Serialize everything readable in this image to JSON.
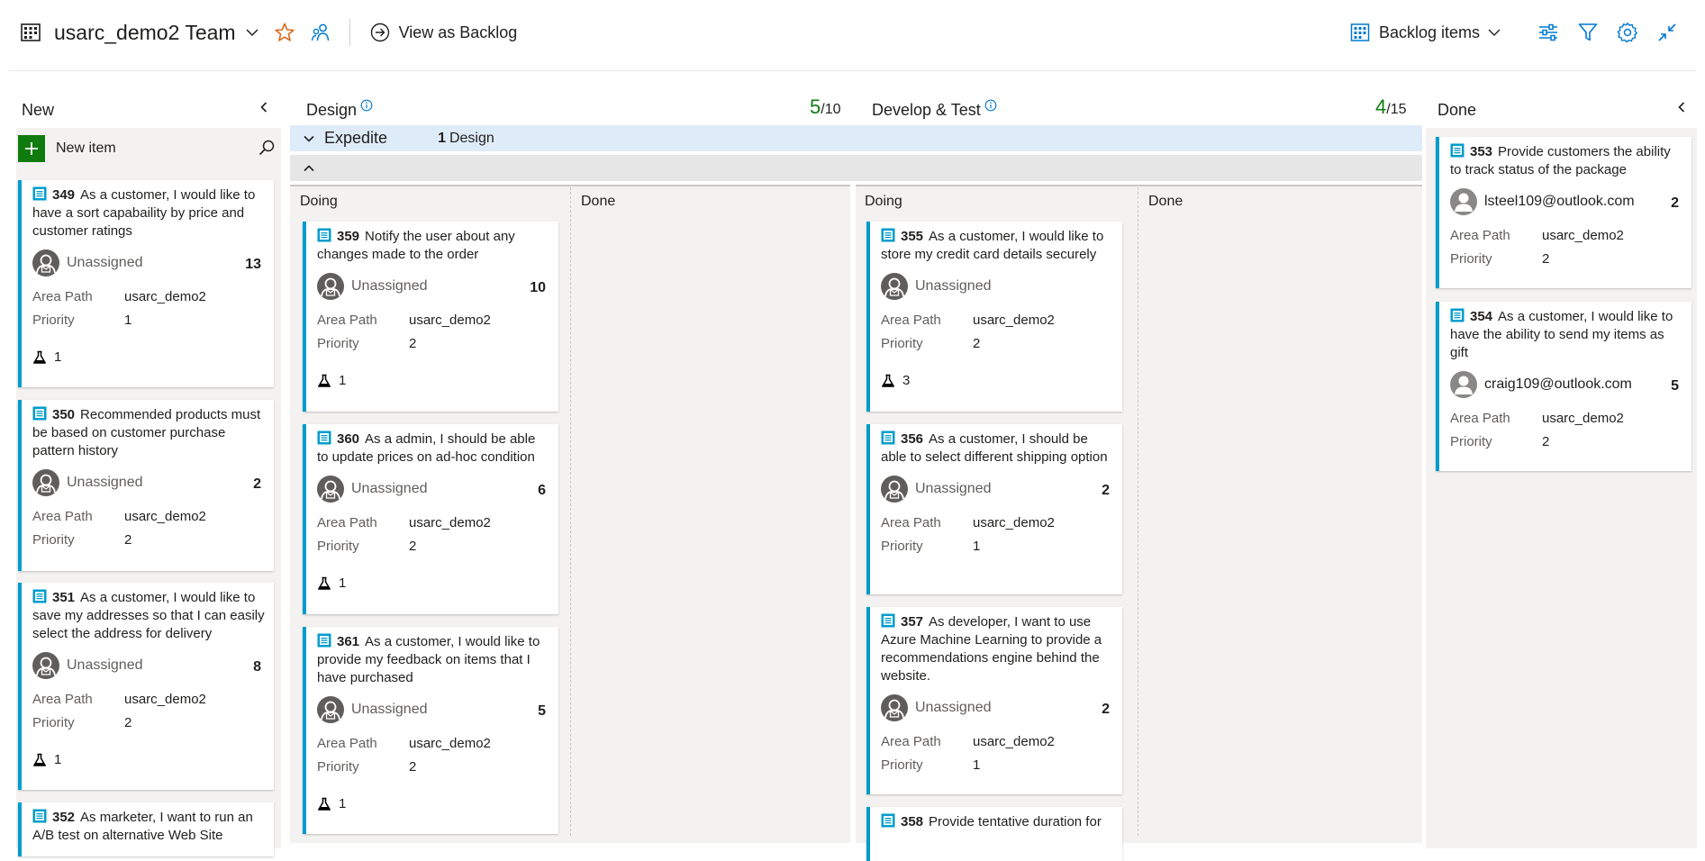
{
  "header": {
    "team_title": "usarc_demo2 Team",
    "view_backlog_label": "View as Backlog",
    "backlog_level_label": "Backlog items"
  },
  "field_labels": {
    "area_path": "Area Path",
    "priority": "Priority"
  },
  "colors": {
    "accent": "#0078d4",
    "card_bar": "#009ccc",
    "favorite": "#d86a1c",
    "wip_good": "#107c10",
    "lane_bg": "#deecf9"
  },
  "columns": {
    "new": {
      "title": "New",
      "new_item_label": "New item",
      "cards": [
        {
          "id": "349",
          "title": "As a customer, I would like to have a sort capabaility by price and customer ratings",
          "assignee": "Unassigned",
          "effort": "13",
          "area_path": "usarc_demo2",
          "priority": "1",
          "tests": "1"
        },
        {
          "id": "350",
          "title": "Recommended products must be based on customer purchase pattern history",
          "assignee": "Unassigned",
          "effort": "2",
          "area_path": "usarc_demo2",
          "priority": "2"
        },
        {
          "id": "351",
          "title": "As a customer, I would like to save my addresses so that I can easily select the address for delivery",
          "assignee": "Unassigned",
          "effort": "8",
          "area_path": "usarc_demo2",
          "priority": "2",
          "tests": "1"
        },
        {
          "id": "352",
          "title": "As marketer, I want to run an A/B test on alternative Web Site"
        }
      ]
    },
    "design": {
      "title": "Design",
      "wip_count": "5",
      "wip_limit": "/10",
      "doing_label": "Doing",
      "done_label": "Done",
      "cards": [
        {
          "id": "359",
          "title": "Notify the user about any changes made to the order",
          "assignee": "Unassigned",
          "effort": "10",
          "area_path": "usarc_demo2",
          "priority": "2",
          "tests": "1"
        },
        {
          "id": "360",
          "title": "As a admin, I should be able to update prices on ad-hoc condition",
          "assignee": "Unassigned",
          "effort": "6",
          "area_path": "usarc_demo2",
          "priority": "2",
          "tests": "1"
        },
        {
          "id": "361",
          "title": "As a customer, I would like to provide my feedback on items that I have purchased",
          "assignee": "Unassigned",
          "effort": "5",
          "area_path": "usarc_demo2",
          "priority": "2",
          "tests": "1"
        }
      ]
    },
    "develop": {
      "title": "Develop & Test",
      "wip_count": "4",
      "wip_limit": "/15",
      "doing_label": "Doing",
      "done_label": "Done",
      "cards": [
        {
          "id": "355",
          "title": "As a customer, I would like to store my credit card details securely",
          "assignee": "Unassigned",
          "area_path": "usarc_demo2",
          "priority": "2",
          "tests": "3"
        },
        {
          "id": "356",
          "title": "As a customer, I should be able to select different shipping option",
          "assignee": "Unassigned",
          "effort": "2",
          "area_path": "usarc_demo2",
          "priority": "1"
        },
        {
          "id": "357",
          "title": "As developer, I want to use Azure Machine Learning to provide a recommendations engine behind the website.",
          "assignee": "Unassigned",
          "effort": "2",
          "area_path": "usarc_demo2",
          "priority": "1"
        },
        {
          "id": "358",
          "title": "Provide tentative duration for"
        }
      ]
    },
    "done": {
      "title": "Done",
      "cards": [
        {
          "id": "353",
          "title": "Provide customers the ability to track status of the package",
          "assignee": "lsteel109@outlook.com",
          "effort": "2",
          "area_path": "usarc_demo2",
          "priority": "2"
        },
        {
          "id": "354",
          "title": "As a customer, I would like to have the ability to send my items as gift",
          "assignee": "craig109@outlook.com",
          "effort": "5",
          "area_path": "usarc_demo2",
          "priority": "2"
        }
      ]
    }
  },
  "swimlane": {
    "name": "Expedite",
    "count": "1",
    "count_label": "Design"
  }
}
